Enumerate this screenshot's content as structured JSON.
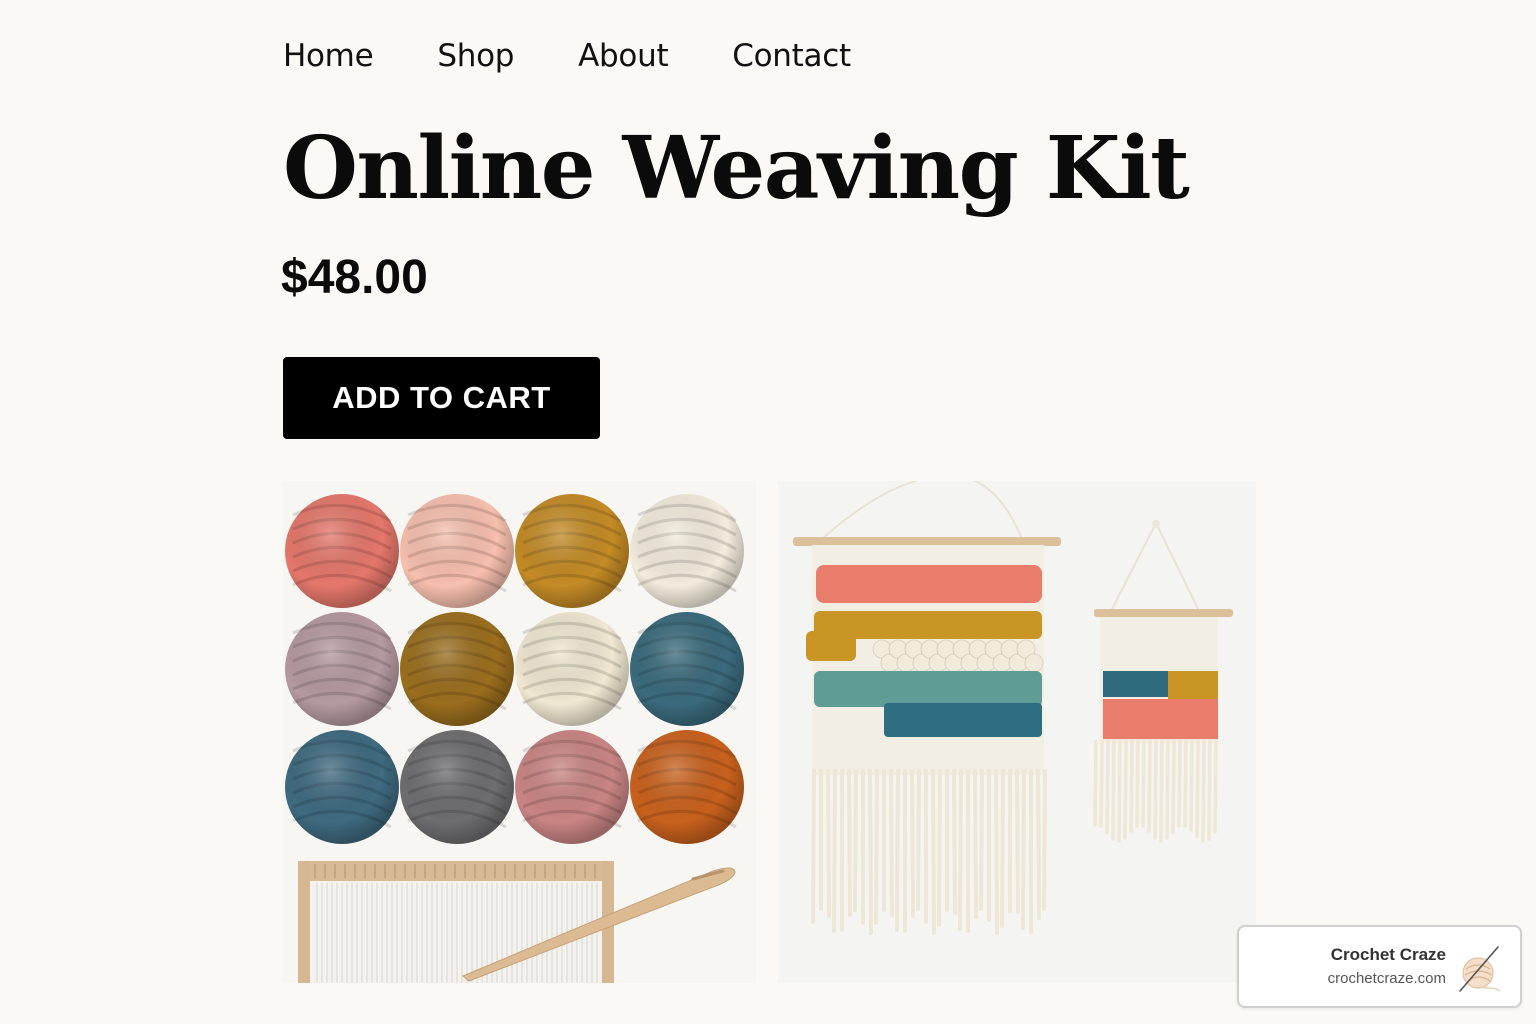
{
  "nav": {
    "items": [
      "Home",
      "Shop",
      "About",
      "Contact"
    ]
  },
  "product": {
    "title": "Online Weaving Kit",
    "price": "$48.00",
    "cta_label": "ADD TO CART"
  },
  "badge": {
    "name": "Crochet Craze",
    "url": "crochetcraze.com"
  },
  "colors": {
    "button_bg": "#000000",
    "background": "#faf9f6",
    "yarn": [
      "#e5776b",
      "#f7bfae",
      "#c48b26",
      "#f3ecdd",
      "#b59aa0",
      "#9a6e1e",
      "#f0e8d2",
      "#3b6b7d",
      "#3f6a80",
      "#6e6e70",
      "#c98584",
      "#c9611d"
    ]
  },
  "icons": [
    "yarn-ball-logo-icon"
  ]
}
